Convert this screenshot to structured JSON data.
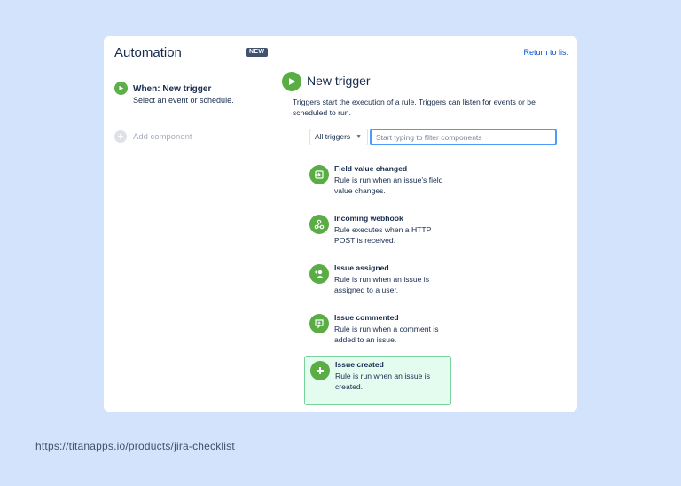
{
  "header": {
    "title": "Automation",
    "badge": "NEW",
    "return_link": "Return to list"
  },
  "rail": {
    "step_title": "When: New trigger",
    "step_subtitle": "Select an event or schedule.",
    "add_label": "Add component"
  },
  "panel": {
    "title": "New trigger",
    "description": "Triggers start the execution of a rule. Triggers can listen for events or be scheduled to run.",
    "filter_select": "All triggers",
    "filter_placeholder": "Start typing to filter components"
  },
  "triggers": [
    {
      "name": "Field value changed",
      "desc": "Rule is run when an issue's field value changes.",
      "icon": "field-change-icon"
    },
    {
      "name": "Incoming webhook",
      "desc": "Rule executes when a HTTP POST is received.",
      "icon": "webhook-icon"
    },
    {
      "name": "Issue assigned",
      "desc": "Rule is run when an issue is assigned to a user.",
      "icon": "user-assign-icon"
    },
    {
      "name": "Issue commented",
      "desc": "Rule is run when a comment is added to an issue.",
      "icon": "comment-icon"
    },
    {
      "name": "Issue created",
      "desc": "Rule is run when an issue is created.",
      "icon": "plus-icon",
      "selected": true
    }
  ],
  "colors": {
    "accent_green": "#5aac44",
    "selected_bg": "#e3fcef",
    "link_blue": "#0052cc",
    "page_bg": "#d2e3fb"
  },
  "footer": {
    "url": "https://titanapps.io/products/jira-checklist"
  }
}
